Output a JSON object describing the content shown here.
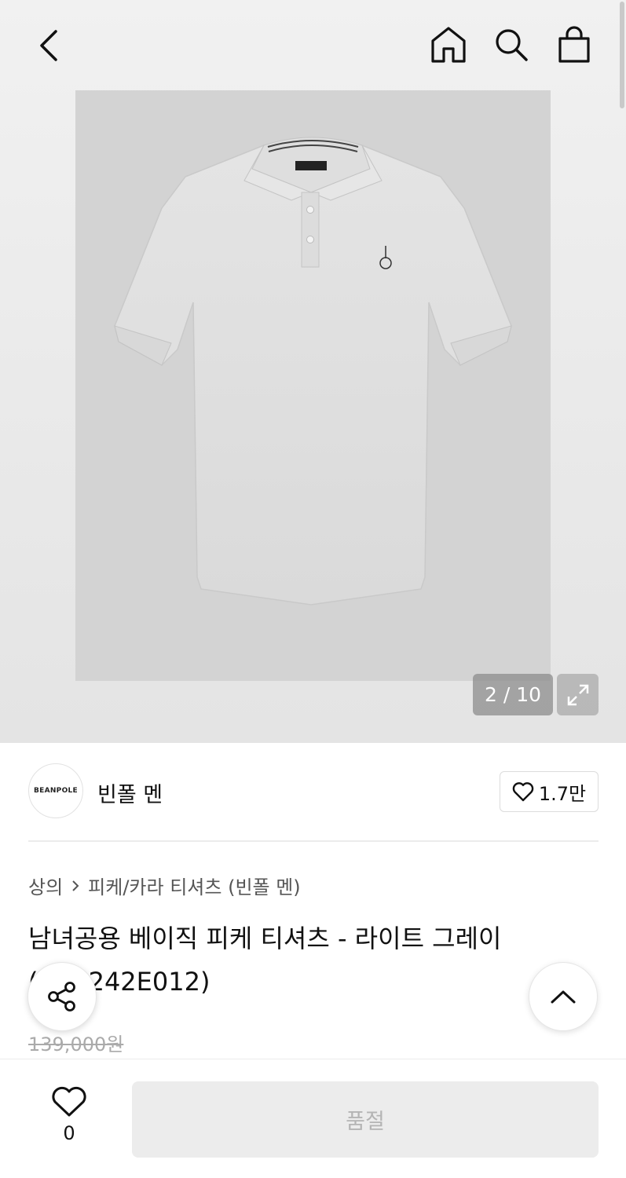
{
  "header": {
    "back_icon": "chevron-left-icon",
    "home_icon": "home-icon",
    "search_icon": "search-icon",
    "bag_icon": "shopping-bag-icon"
  },
  "gallery": {
    "counter": "2 / 10",
    "expand_icon": "expand-icon",
    "image_description": "light gray pique polo shirt"
  },
  "brand": {
    "logo_text": "BEANPOLE",
    "name": "빈폴 멘",
    "favorite_count": "1.7만",
    "heart_icon": "heart-icon"
  },
  "breadcrumb": {
    "level1": "상의",
    "separator_icon": "chevron-right-icon",
    "level2": "피케/카라 티셔츠 (빈폴 멘)"
  },
  "product": {
    "title": "남녀공용 베이직 피케 티셔츠 - 라이트 그레이 (BC3242E012)",
    "original_price": "139,000원"
  },
  "floating": {
    "share_icon": "share-icon",
    "scroll_up_icon": "chevron-up-icon"
  },
  "bottom_bar": {
    "like_count": "0",
    "soldout_label": "품절"
  },
  "colors": {
    "background_top": "#eeeeee",
    "soldout_bg": "#ececec",
    "soldout_text": "#b4b4b4",
    "counter_bg": "#8c8c8c"
  }
}
